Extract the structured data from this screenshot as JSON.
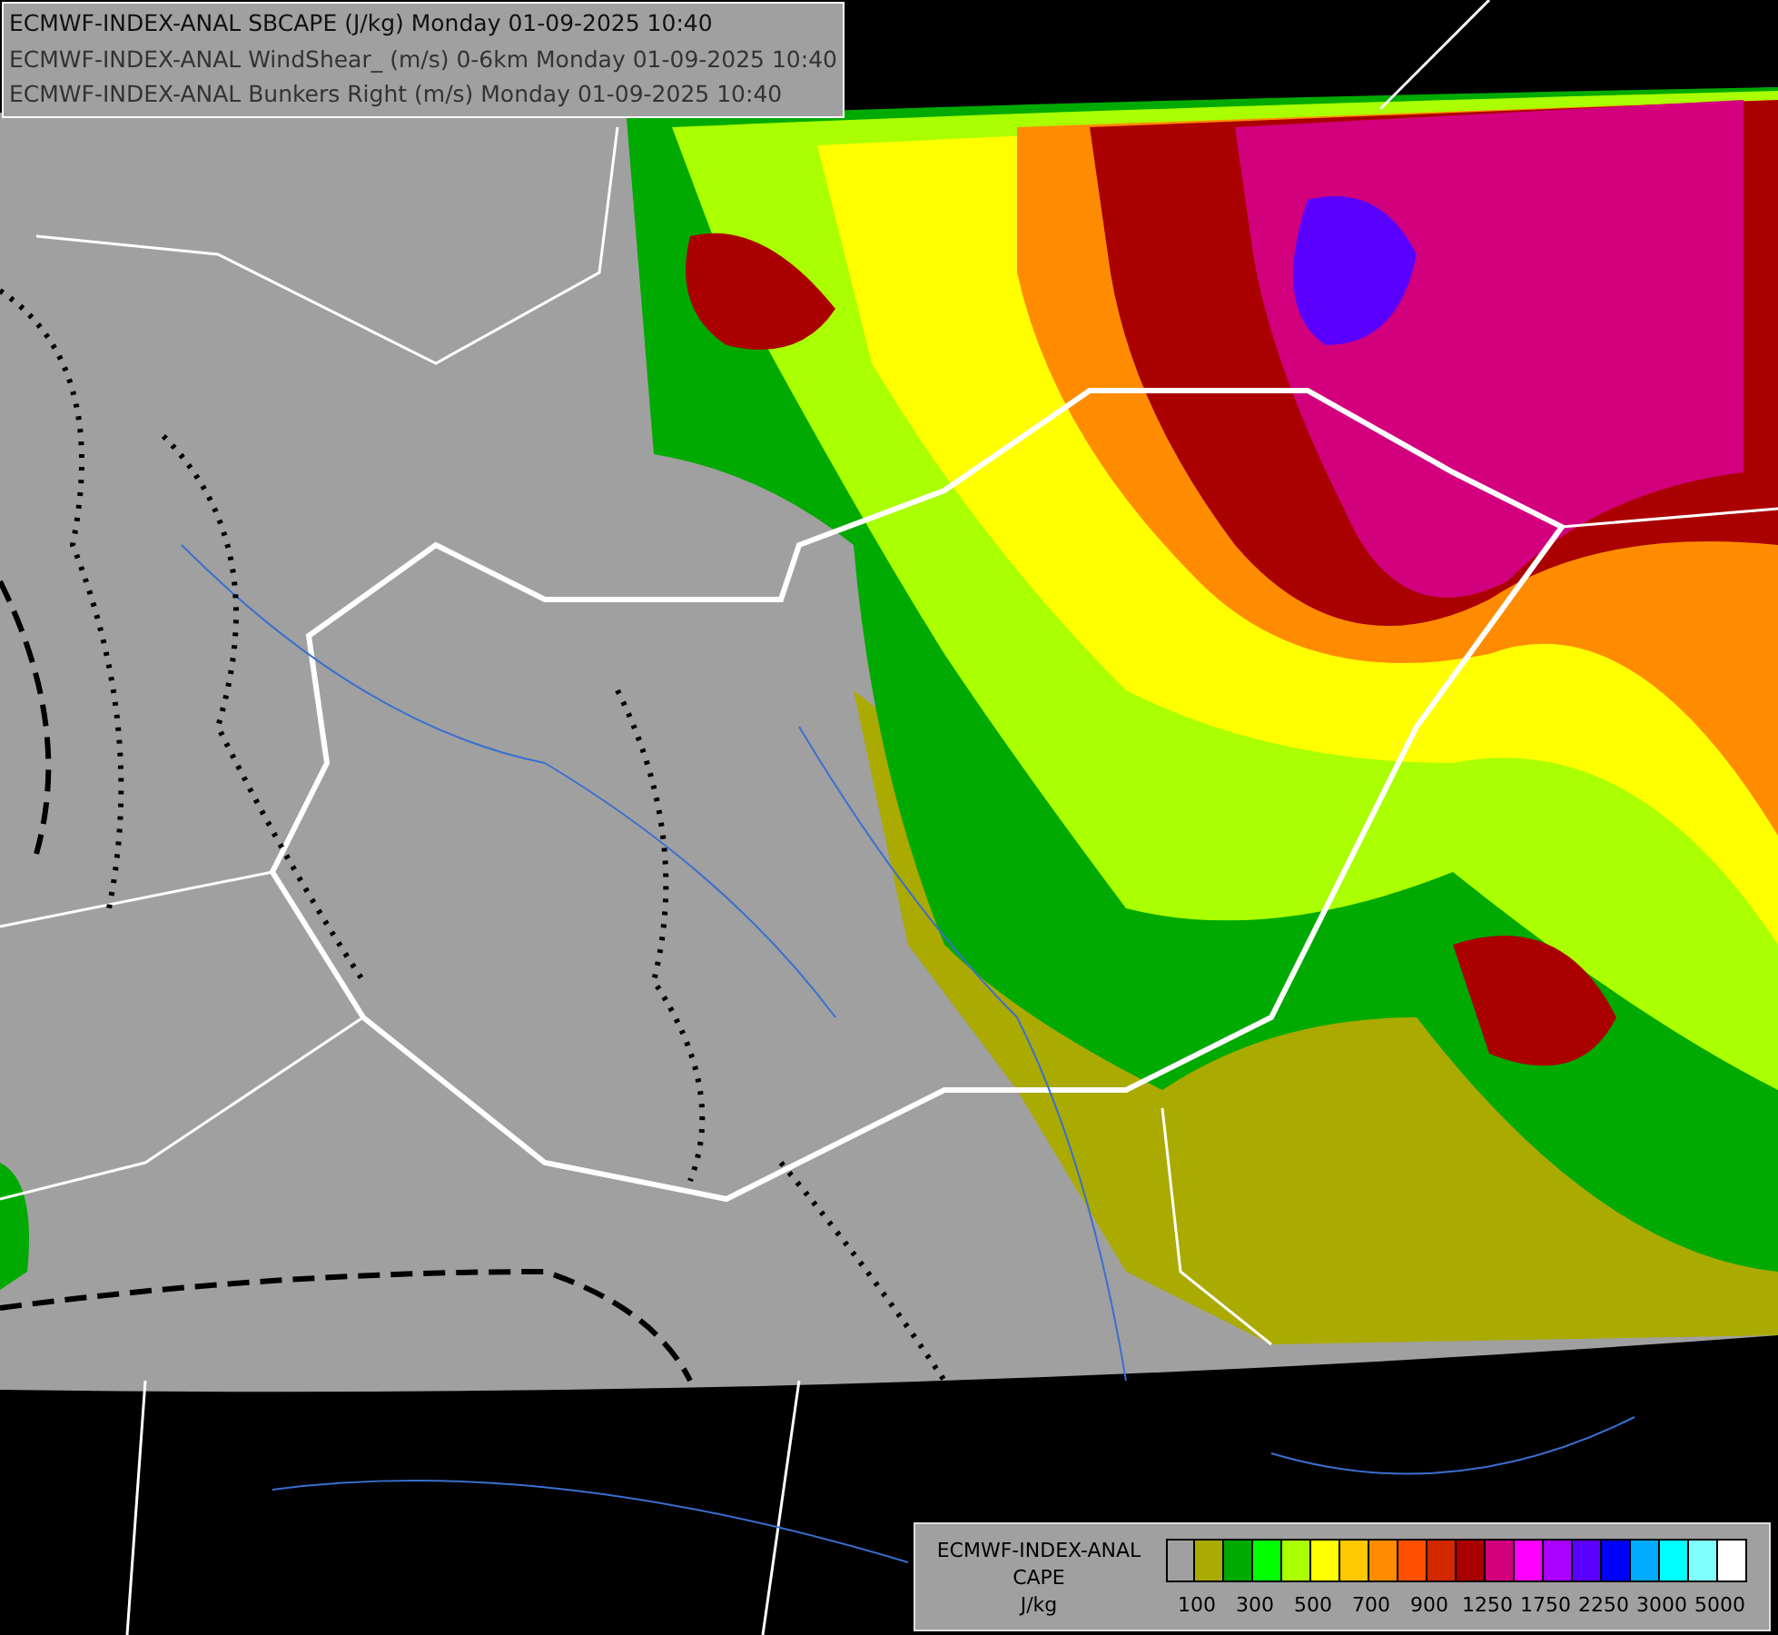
{
  "header": {
    "lines": [
      "ECMWF-INDEX-ANAL SBCAPE (J/kg) Monday 01-09-2025 10:40",
      "ECMWF-INDEX-ANAL WindShear_ (m/s) 0-6km Monday 01-09-2025 10:40",
      "ECMWF-INDEX-ANAL Bunkers Right (m/s) Monday 01-09-2025 10:40"
    ]
  },
  "legend": {
    "title_lines": [
      "ECMWF-INDEX-ANAL",
      "CAPE",
      "J/kg"
    ],
    "swatches": [
      {
        "color": "#a0a0a0"
      },
      {
        "color": "#aaaa00"
      },
      {
        "color": "#00aa00"
      },
      {
        "color": "#00ff00"
      },
      {
        "color": "#aaff00"
      },
      {
        "color": "#ffff00"
      },
      {
        "color": "#ffc800"
      },
      {
        "color": "#ff8c00"
      },
      {
        "color": "#ff5000"
      },
      {
        "color": "#d22800"
      },
      {
        "color": "#aa0000"
      },
      {
        "color": "#d2007d"
      },
      {
        "color": "#ff00ff"
      },
      {
        "color": "#aa00ff"
      },
      {
        "color": "#5a00ff"
      },
      {
        "color": "#0000ff"
      },
      {
        "color": "#00aaff"
      },
      {
        "color": "#00ffff"
      },
      {
        "color": "#80ffff"
      },
      {
        "color": "#ffffff"
      }
    ],
    "tick_labels": [
      "100",
      "300",
      "500",
      "700",
      "900",
      "1250",
      "1750",
      "2250",
      "3000",
      "5000"
    ]
  }
}
